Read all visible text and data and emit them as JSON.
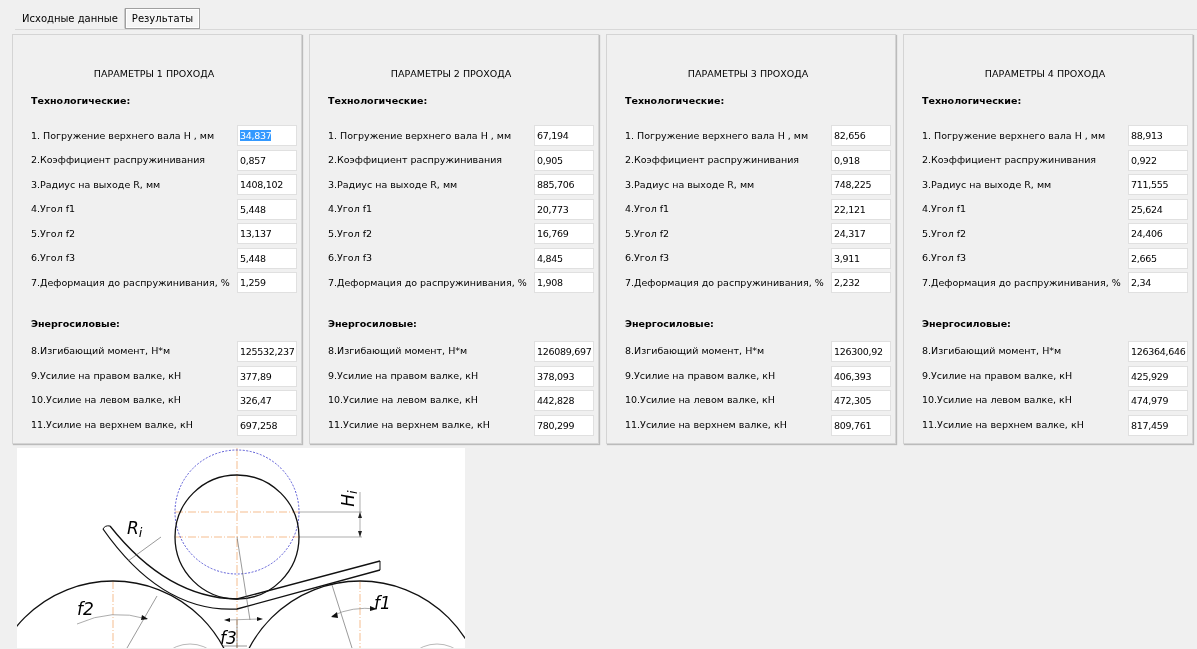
{
  "tabs": [
    {
      "label": "Исходные данные",
      "selected": false
    },
    {
      "label": "Результаты",
      "selected": true
    }
  ],
  "passes": [
    {
      "title": "ПАРАМЕТРЫ  1 ПРОХОДА",
      "sections": [
        {
          "heading": "Технологические:",
          "rows": [
            {
              "label": "1. Погружение верхнего вала Н , мм",
              "value": "34,837",
              "highlighted": true
            },
            {
              "label": "2.Коэффициент распружинивания",
              "value": "0,857",
              "highlighted": false
            },
            {
              "label": "3.Радиус на выходе R, мм",
              "value": "1408,102",
              "highlighted": false
            },
            {
              "label": "4.Угол f1",
              "value": "5,448",
              "highlighted": false
            },
            {
              "label": "5.Угол f2",
              "value": "13,137",
              "highlighted": false
            },
            {
              "label": "6.Угол f3",
              "value": "5,448",
              "highlighted": false
            },
            {
              "label": "7.Деформация до распружинивания, %",
              "value": "1,259",
              "highlighted": false
            }
          ]
        },
        {
          "heading": "Энергосиловые:",
          "rows": [
            {
              "label": "8.Изгибающий момент, Н*м",
              "value": "125532,237",
              "highlighted": false
            },
            {
              "label": "9.Усилие на правом валке, кН",
              "value": "377,89",
              "highlighted": false
            },
            {
              "label": "10.Усилие на левом валке, кН",
              "value": "326,47",
              "highlighted": false
            },
            {
              "label": "11.Усилие на верхнем валке, кН",
              "value": "697,258",
              "highlighted": false
            }
          ]
        }
      ]
    },
    {
      "title": "ПАРАМЕТРЫ 2 ПРОХОДА",
      "sections": [
        {
          "heading": "Технологические:",
          "rows": [
            {
              "label": "1. Погружение верхнего вала Н , мм",
              "value": "67,194",
              "highlighted": false
            },
            {
              "label": "2.Коэффициент распружинивания",
              "value": "0,905",
              "highlighted": false
            },
            {
              "label": "3.Радиус на выходе R, мм",
              "value": "885,706",
              "highlighted": false
            },
            {
              "label": "4.Угол f1",
              "value": "20,773",
              "highlighted": false
            },
            {
              "label": "5.Угол f2",
              "value": "16,769",
              "highlighted": false
            },
            {
              "label": "6.Угол f3",
              "value": "4,845",
              "highlighted": false
            },
            {
              "label": "7.Деформация до распружинивания, %",
              "value": "1,908",
              "highlighted": false
            }
          ]
        },
        {
          "heading": "Энергосиловые:",
          "rows": [
            {
              "label": "8.Изгибающий момент, Н*м",
              "value": "126089,697",
              "highlighted": false
            },
            {
              "label": "9.Усилие на правом валке, кН",
              "value": "378,093",
              "highlighted": false
            },
            {
              "label": "10.Усилие на левом валке, кН",
              "value": "442,828",
              "highlighted": false
            },
            {
              "label": "11.Усилие на верхнем валке, кН",
              "value": "780,299",
              "highlighted": false
            }
          ]
        }
      ]
    },
    {
      "title": "ПАРАМЕТРЫ 3 ПРОХОДА",
      "sections": [
        {
          "heading": "Технологические:",
          "rows": [
            {
              "label": "1. Погружение верхнего вала Н , мм",
              "value": "82,656",
              "highlighted": false
            },
            {
              "label": "2.Коэффициент распружинивания",
              "value": "0,918",
              "highlighted": false
            },
            {
              "label": "3.Радиус на выходе R, мм",
              "value": "748,225",
              "highlighted": false
            },
            {
              "label": "4.Угол f1",
              "value": "22,121",
              "highlighted": false
            },
            {
              "label": "5.Угол f2",
              "value": "24,317",
              "highlighted": false
            },
            {
              "label": "6.Угол f3",
              "value": "3,911",
              "highlighted": false
            },
            {
              "label": "7.Деформация до распружинивания, %",
              "value": "2,232",
              "highlighted": false
            }
          ]
        },
        {
          "heading": "Энергосиловые:",
          "rows": [
            {
              "label": "8.Изгибающий момент, Н*м",
              "value": "126300,92",
              "highlighted": false
            },
            {
              "label": "9.Усилие на правом валке, кН",
              "value": "406,393",
              "highlighted": false
            },
            {
              "label": "10.Усилие на левом валке, кН",
              "value": "472,305",
              "highlighted": false
            },
            {
              "label": "11.Усилие на верхнем валке, кН",
              "value": "809,761",
              "highlighted": false
            }
          ]
        }
      ]
    },
    {
      "title": "ПАРАМЕТРЫ 4 ПРОХОДА",
      "sections": [
        {
          "heading": "Технологические:",
          "rows": [
            {
              "label": "1. Погружение верхнего вала Н , мм",
              "value": "88,913",
              "highlighted": false
            },
            {
              "label": "2.Коэффициент распружинивания",
              "value": "0,922",
              "highlighted": false
            },
            {
              "label": "3.Радиус на выходе R, мм",
              "value": "711,555",
              "highlighted": false
            },
            {
              "label": "4.Угол f1",
              "value": "25,624",
              "highlighted": false
            },
            {
              "label": "5.Угол f2",
              "value": "24,406",
              "highlighted": false
            },
            {
              "label": "6.Угол f3",
              "value": "2,665",
              "highlighted": false
            },
            {
              "label": "7.Деформация до распружинивания, %",
              "value": "2,34",
              "highlighted": false
            }
          ]
        },
        {
          "heading": "Энергосиловые:",
          "rows": [
            {
              "label": "8.Изгибающий момент, Н*м",
              "value": "126364,646",
              "highlighted": false
            },
            {
              "label": "9.Усилие на правом валке, кН",
              "value": "425,929",
              "highlighted": false
            },
            {
              "label": "10.Усилие на левом валке, кН",
              "value": "474,979",
              "highlighted": false
            },
            {
              "label": "11.Усилие на верхнем валке, кН",
              "value": "817,459",
              "highlighted": false
            }
          ]
        }
      ]
    }
  ],
  "diagram": {
    "labels": [
      "R$_{i}$",
      "H$_{i}$",
      "f2",
      "f1",
      "f3"
    ]
  }
}
